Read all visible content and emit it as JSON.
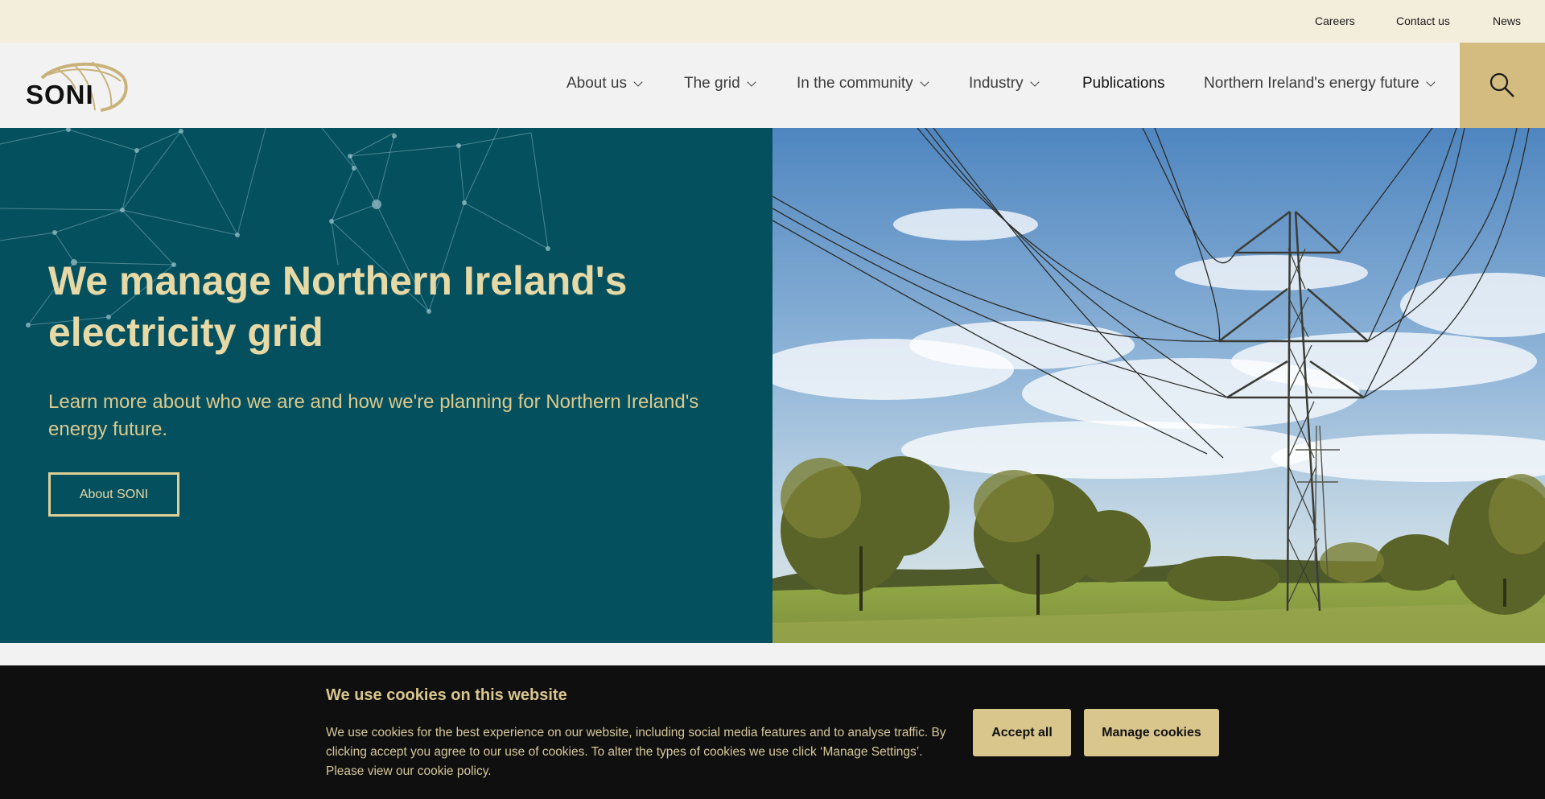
{
  "utility_nav": [
    "Careers",
    "Contact us",
    "News"
  ],
  "logo": {
    "text": "SONI"
  },
  "main_nav": [
    {
      "label": "About us",
      "has_dropdown": true
    },
    {
      "label": "The grid",
      "has_dropdown": true
    },
    {
      "label": "In the community",
      "has_dropdown": true
    },
    {
      "label": "Industry",
      "has_dropdown": true
    },
    {
      "label": "Publications",
      "has_dropdown": false
    },
    {
      "label": "Northern Ireland's energy future",
      "has_dropdown": true
    }
  ],
  "search": {
    "icon": "search-icon"
  },
  "hero": {
    "title": "We manage Northern Ireland's electricity grid",
    "subtitle": "Learn more about who we are and how we're planning for Northern Ireland's energy future.",
    "button": "About SONI",
    "image_description_icon": "pylon-landscape-image"
  },
  "cookie_banner": {
    "title": "We use cookies on this website",
    "text": "We use cookies for the best experience on our website, including social media features and to analyse traffic. By clicking accept you agree to our use of cookies. To alter the types of cookies we use click ‘Manage Settings’. Please view our cookie policy.",
    "accept_label": "Accept all",
    "manage_label": "Manage cookies"
  },
  "colors": {
    "utility_bg": "#f3eddb",
    "hero_teal": "#05505f",
    "accent_gold": "#d4bc80",
    "cookie_bg": "#0f0f0f"
  }
}
